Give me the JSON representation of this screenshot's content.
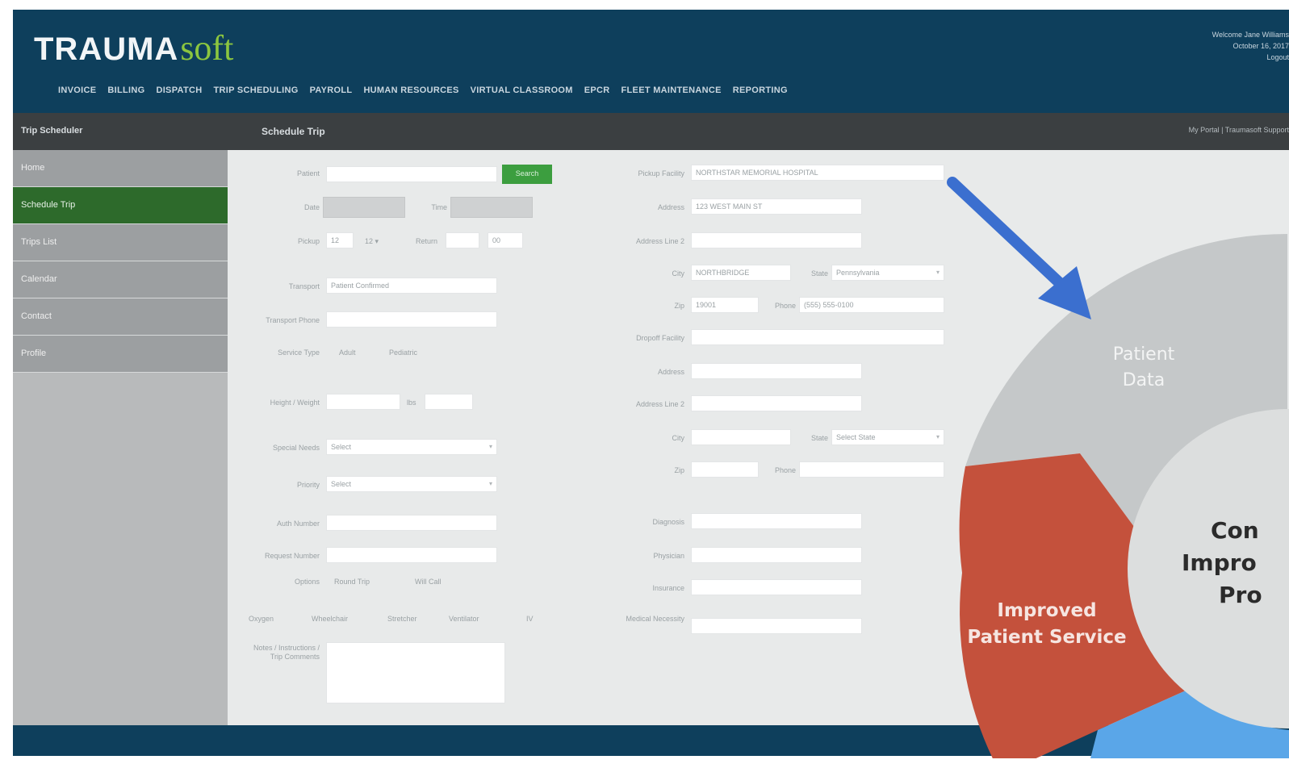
{
  "app": {
    "logo_bold": "TRAUMA",
    "logo_light": "soft"
  },
  "header": {
    "nav": [
      "INVOICE",
      "BILLING",
      "DISPATCH",
      "TRIP SCHEDULING",
      "PAYROLL",
      "HUMAN RESOURCES",
      "VIRTUAL CLASSROOM",
      "EPCR",
      "FLEET MAINTENANCE",
      "REPORTING"
    ],
    "welcome": [
      "Welcome Jane Williams",
      "October 16, 2017",
      "Logout"
    ]
  },
  "breadcrumb": {
    "section": "Trip Scheduler",
    "title": "Schedule Trip",
    "links": "My Portal | Traumasoft Support"
  },
  "sidebar": {
    "items": [
      "Home",
      "Schedule Trip",
      "Trips List",
      "Calendar",
      "Contact",
      "Profile"
    ],
    "active_index": 1
  },
  "form": {
    "search_label": "Patient",
    "search_button": "Search",
    "date_label": "Date",
    "time_label": "Time",
    "pickup_label": "Pickup",
    "pickup_hour": "12",
    "return_label": "Return",
    "return_min": "00",
    "transport_label": "Transport",
    "transport_value": "Patient Confirmed",
    "transport_phone_label": "Transport Phone",
    "service_label": "Service Type",
    "service_value": "Adult",
    "service_alt": "Pediatric",
    "weight_label": "Height / Weight",
    "weight_unit": "lbs",
    "special_label": "Special Needs",
    "special_value": "Select",
    "priority_label": "Priority",
    "priority_value": "Select",
    "auth_label": "Auth Number",
    "request_label": "Request Number",
    "options_label": "Options",
    "options": [
      "Round Trip",
      "Will Call"
    ],
    "equipment": [
      "Oxygen",
      "Wheelchair",
      "Stretcher",
      "Ventilator",
      "IV"
    ],
    "notes_label": "Notes / Instructions / Trip Comments",
    "facility_label": "Pickup Facility",
    "facility_value": "NORTHSTAR MEMORIAL HOSPITAL",
    "address_label": "Address",
    "address_value": "123 WEST MAIN ST",
    "address2_label": "Address Line 2",
    "city_label": "City",
    "city_value": "NORTHBRIDGE",
    "state_label": "State",
    "state_value": "Pennsylvania",
    "zip_label": "Zip",
    "zip_value": "19001",
    "phone_label": "Phone",
    "phone_value": "(555) 555-0100",
    "dest_facility_label": "Dropoff Facility",
    "dest_address_label": "Address",
    "dest_address2_label": "Address Line 2",
    "dest_city_label": "City",
    "dest_state_label": "State",
    "dest_state_value": "Select State",
    "dest_zip_label": "Zip",
    "dest_phone_label": "Phone",
    "diagnosis_label": "Diagnosis",
    "physician_label": "Physician",
    "insurance_label": "Insurance",
    "medical_label": "Medical Necessity"
  },
  "overlay": {
    "segment_patient": [
      "Patient",
      "Data"
    ],
    "segment_service": [
      "Improved",
      "Patient Service"
    ],
    "center": [
      "Con",
      "Impro",
      "Pro"
    ],
    "colors": {
      "arrow": "#3b6fcf",
      "grey": "#c5c8c9",
      "red": "#c4513c",
      "blue": "#5aa6e8",
      "center": "#dcdede",
      "center_text": "#2b2b2b"
    }
  }
}
